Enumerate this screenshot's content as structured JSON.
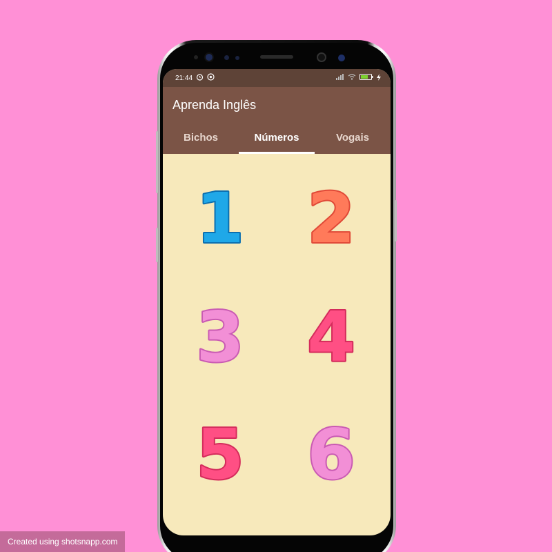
{
  "status_bar": {
    "time": "21:44",
    "battery_color": "#7dd330"
  },
  "app_bar": {
    "title": "Aprenda Inglês",
    "background": "#7b5446"
  },
  "tabs": [
    {
      "label": "Bichos",
      "active": false
    },
    {
      "label": "Números",
      "active": true
    },
    {
      "label": "Vogais",
      "active": false
    }
  ],
  "numbers": [
    {
      "label": "1",
      "fill": "#1fa8e8",
      "outline": "#0b6fb0"
    },
    {
      "label": "2",
      "fill": "#ff7a5a",
      "outline": "#e04a38"
    },
    {
      "label": "3",
      "fill": "#f28fd6",
      "outline": "#c95bb3"
    },
    {
      "label": "4",
      "fill": "#ff4f84",
      "outline": "#d42c5c"
    },
    {
      "label": "5",
      "fill": "#ff4f84",
      "outline": "#d42c5c"
    },
    {
      "label": "6",
      "fill": "#f28fd6",
      "outline": "#c95bb3"
    }
  ],
  "colors": {
    "page_background": "#ff90d6",
    "content_background": "#f7e9bb"
  },
  "watermark": "Created using shotsnapp.com"
}
